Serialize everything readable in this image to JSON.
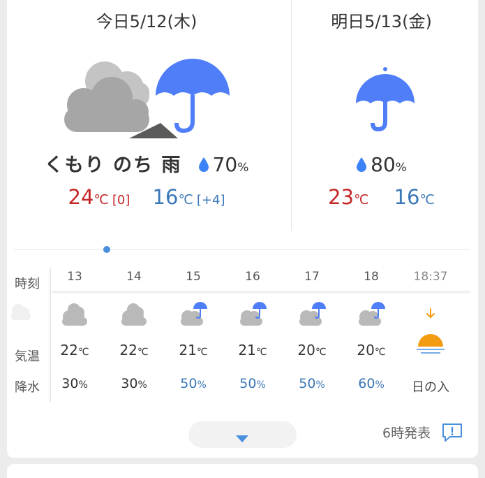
{
  "today": {
    "date": "今日5/12(木)",
    "weather": "くもり のち 雨",
    "pop_value": "70",
    "pop_unit": "%",
    "high": "24",
    "high_unit": "℃",
    "high_diff": "[0]",
    "low": "16",
    "low_unit": "℃",
    "low_diff": "[+4]",
    "icon": "cloudy-then-rain-icon"
  },
  "tomorrow": {
    "date": "明日5/13(金)",
    "pop_value": "80",
    "pop_unit": "%",
    "high": "23",
    "high_unit": "℃",
    "low": "16",
    "low_unit": "℃",
    "icon": "umbrella-icon"
  },
  "hourly": {
    "labels": {
      "time": "時刻",
      "temp": "気温",
      "pop": "降水"
    },
    "temp_unit": "℃",
    "pop_unit": "%",
    "hours": [
      {
        "time": "13",
        "icon": "cloud-icon",
        "temp": "22",
        "pop": "30",
        "pop_color": "#333333"
      },
      {
        "time": "14",
        "icon": "cloud-icon",
        "temp": "22",
        "pop": "30",
        "pop_color": "#333333"
      },
      {
        "time": "15",
        "icon": "cloud-rain-icon",
        "temp": "21",
        "pop": "50",
        "pop_color": "#3b78b7"
      },
      {
        "time": "16",
        "icon": "cloud-rain-icon",
        "temp": "21",
        "pop": "50",
        "pop_color": "#3b78b7"
      },
      {
        "time": "17",
        "icon": "cloud-rain-icon",
        "temp": "20",
        "pop": "50",
        "pop_color": "#3b78b7"
      },
      {
        "time": "18",
        "icon": "cloud-rain-icon",
        "temp": "20",
        "pop": "60",
        "pop_color": "#3b78b7"
      }
    ],
    "sunset": {
      "time": "18:37",
      "label": "日の入",
      "icon": "sunset-icon"
    }
  },
  "footer": {
    "announce": "6時発表",
    "expand_icon": "chevron-down-icon",
    "feedback_icon": "feedback-icon"
  },
  "colors": {
    "high": "#c62828",
    "low": "#3b78b7",
    "umbrella": "#4f7ef8",
    "cloud": "#a9a9a9",
    "sun": "#f39c12"
  }
}
